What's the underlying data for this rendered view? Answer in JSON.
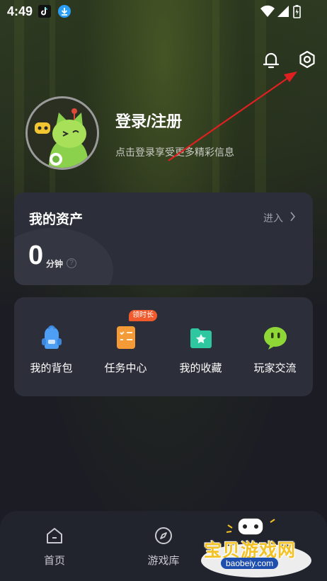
{
  "status_bar": {
    "time": "4:49",
    "app_icons": [
      "tiktok-icon",
      "download-icon"
    ],
    "right_icons": [
      "wifi-icon",
      "signal-icon",
      "battery-charging-icon"
    ]
  },
  "header": {
    "icons": [
      "bell-icon",
      "settings-gear-icon"
    ]
  },
  "profile": {
    "login_label": "登录/注册",
    "login_hint": "点击登录享受更多精彩信息"
  },
  "assets": {
    "title": "我的资产",
    "enter_label": "进入",
    "value": "0",
    "unit": "分钟"
  },
  "actions": {
    "items": [
      {
        "label": "我的背包",
        "icon": "backpack-icon"
      },
      {
        "label": "任务中心",
        "icon": "task-list-icon",
        "badge": "领时长"
      },
      {
        "label": "我的收藏",
        "icon": "favorite-folder-icon"
      },
      {
        "label": "玩家交流",
        "icon": "chat-bubble-icon"
      }
    ]
  },
  "nav": {
    "items": [
      {
        "label": "首页",
        "icon": "home-icon"
      },
      {
        "label": "游戏库",
        "icon": "compass-icon"
      }
    ]
  },
  "watermark": {
    "title": "宝贝游戏网",
    "url": "baobeiy.com"
  },
  "colors": {
    "background": "#1b1c24",
    "card": "#2c2f3a",
    "badge": "#f15a2c",
    "arrow": "#e02020"
  }
}
